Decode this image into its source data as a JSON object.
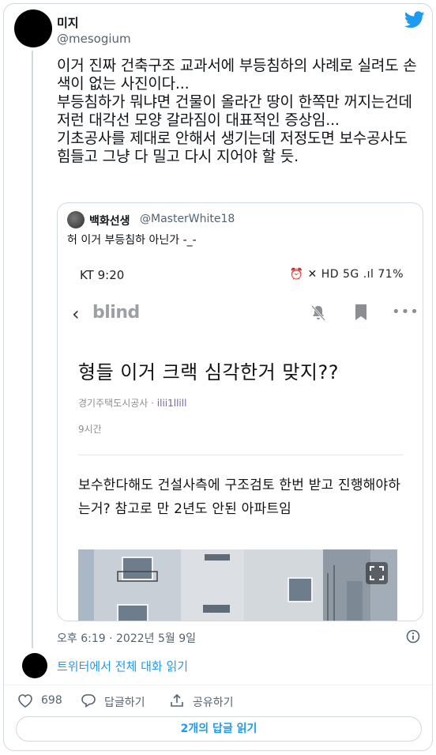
{
  "tweet": {
    "display_name": "미지",
    "handle": "@mesogium",
    "text": "이거 진짜 건축구조 교과서에 부등침하의 사례로 실려도 손색이 없는 사진이다...\n부등침하가 뭐냐면 건물이 올라간 땅이 한쪽만 꺼지는건데 저런 대각선 모양 갈라짐이 대표적인 증상임...\n기초공사를 제대로 안해서 생기는데 저정도면 보수공사도 힘들고 그냥 다 밀고 다시 지어야 할 듯.",
    "timestamp": "오후 6:19 · 2022년 5월 9일",
    "icons": {
      "brand": "twitter-bird-icon",
      "info": "info-icon"
    },
    "brand_color": "#1d9bf0"
  },
  "quote": {
    "display_name": "백화선생",
    "handle": "@MasterWhite18",
    "text": "허 이거 부등침하 아닌가 -_-",
    "screenshot": {
      "status_left": "KT 9:20",
      "status_right": "⏰ ✕ HD 5G .ıl 71%",
      "app_name": "blind",
      "post_title": "형들 이거 크랙 심각한거 맞지??",
      "company": "경기주택도시공사",
      "nickname": "ilii1llill",
      "posted_ago": "9시간",
      "body": "보수한다해도 건설사측에 구조검토 한번 받고 진행해야하는거? 참고로 만 2년도 안된 아파트임"
    }
  },
  "conversation_link": "트위터에서 전체 대화 읽기",
  "actions": {
    "like_count": "698",
    "reply_label": "답글하기",
    "share_label": "공유하기"
  },
  "replies_button": "2개의 답글 읽기"
}
